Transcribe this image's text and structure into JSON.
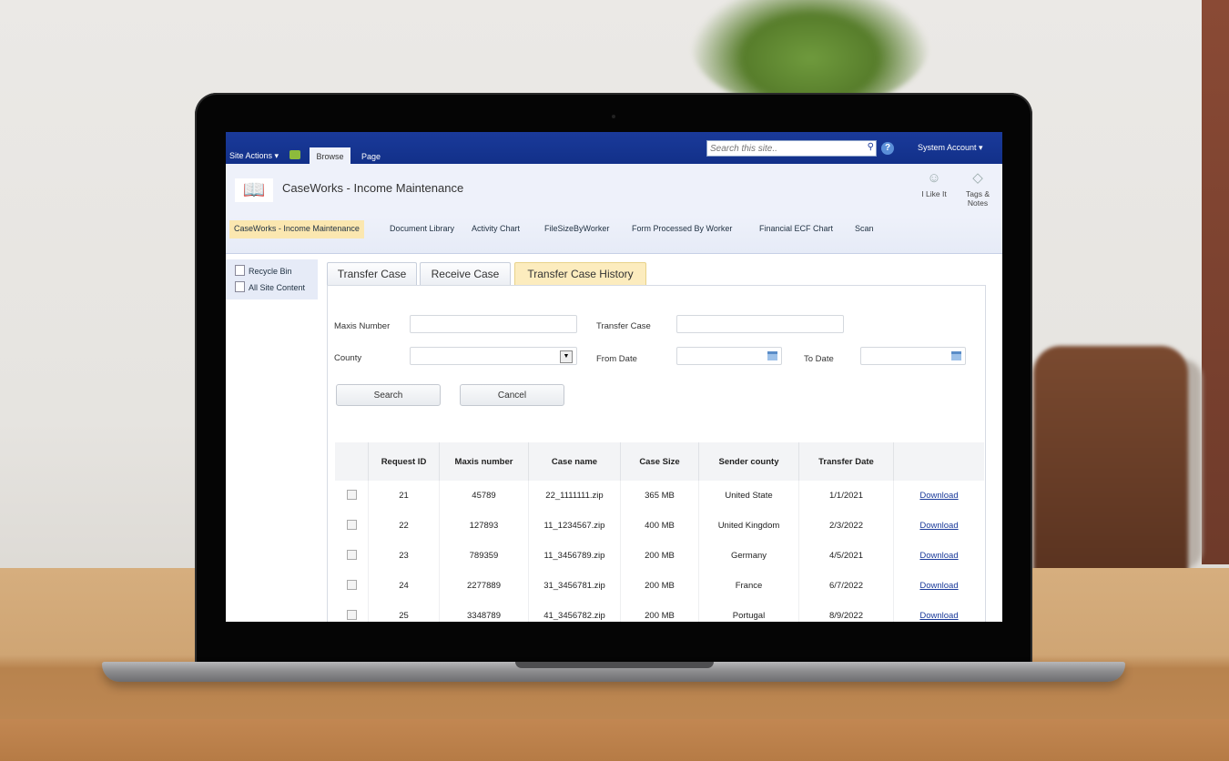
{
  "window": {
    "title": "CaseWorks - Income Maintenance"
  },
  "ribbon": {
    "site_actions": "Site Actions ▾",
    "tabs": [
      "Browse",
      "Page"
    ],
    "active_tab": "Browse",
    "search_placeholder": "Search this site..",
    "help": "?",
    "account": "System Account ▾"
  },
  "header": {
    "site_title": "CaseWorks - Income Maintenance",
    "like_it": "I Like It",
    "tags_notes_1": "Tags &",
    "tags_notes_2": "Notes"
  },
  "topnav": {
    "items": [
      {
        "label": "CaseWorks - Income Maintenance",
        "active": true
      },
      {
        "label": "Document Library"
      },
      {
        "label": "Activity Chart"
      },
      {
        "label": "FileSizeByWorker"
      },
      {
        "label": "Form Processed By Worker"
      },
      {
        "label": "Financial ECF Chart"
      },
      {
        "label": "Scan"
      }
    ]
  },
  "leftnav": {
    "items": [
      {
        "label": "Recycle Bin"
      },
      {
        "label": "All Site Content"
      }
    ]
  },
  "tabs": [
    {
      "label": "Transfer Case"
    },
    {
      "label": "Receive Case"
    },
    {
      "label": "Transfer Case History",
      "active": true
    }
  ],
  "form": {
    "maxis_number_label": "Maxis Number",
    "maxis_number_value": "",
    "transfer_case_label": "Transfer Case",
    "transfer_case_value": "",
    "county_label": "County",
    "county_value": "",
    "from_date_label": "From Date",
    "from_date_value": "",
    "to_date_label": "To Date",
    "to_date_value": "",
    "search_button": "Search",
    "cancel_button": "Cancel"
  },
  "table": {
    "headers": [
      "",
      "Request ID",
      "Maxis number",
      "Case name",
      "Case Size",
      "Sender county",
      "Transfer Date",
      ""
    ],
    "rows": [
      {
        "id": "21",
        "maxis": "45789",
        "case": "22_1111111.zip",
        "size": "365 MB",
        "county": "United State",
        "date": "1/1/2021",
        "action": "Download"
      },
      {
        "id": "22",
        "maxis": "127893",
        "case": "11_1234567.zip",
        "size": "400 MB",
        "county": "United Kingdom",
        "date": "2/3/2022",
        "action": "Download"
      },
      {
        "id": "23",
        "maxis": "789359",
        "case": "11_3456789.zip",
        "size": "200 MB",
        "county": "Germany",
        "date": "4/5/2021",
        "action": "Download"
      },
      {
        "id": "24",
        "maxis": "2277889",
        "case": "31_3456781.zip",
        "size": "200 MB",
        "county": "France",
        "date": "6/7/2022",
        "action": "Download"
      },
      {
        "id": "25",
        "maxis": "3348789",
        "case": "41_3456782.zip",
        "size": "200 MB",
        "county": "Portugal",
        "date": "8/9/2022",
        "action": "Download"
      }
    ]
  }
}
